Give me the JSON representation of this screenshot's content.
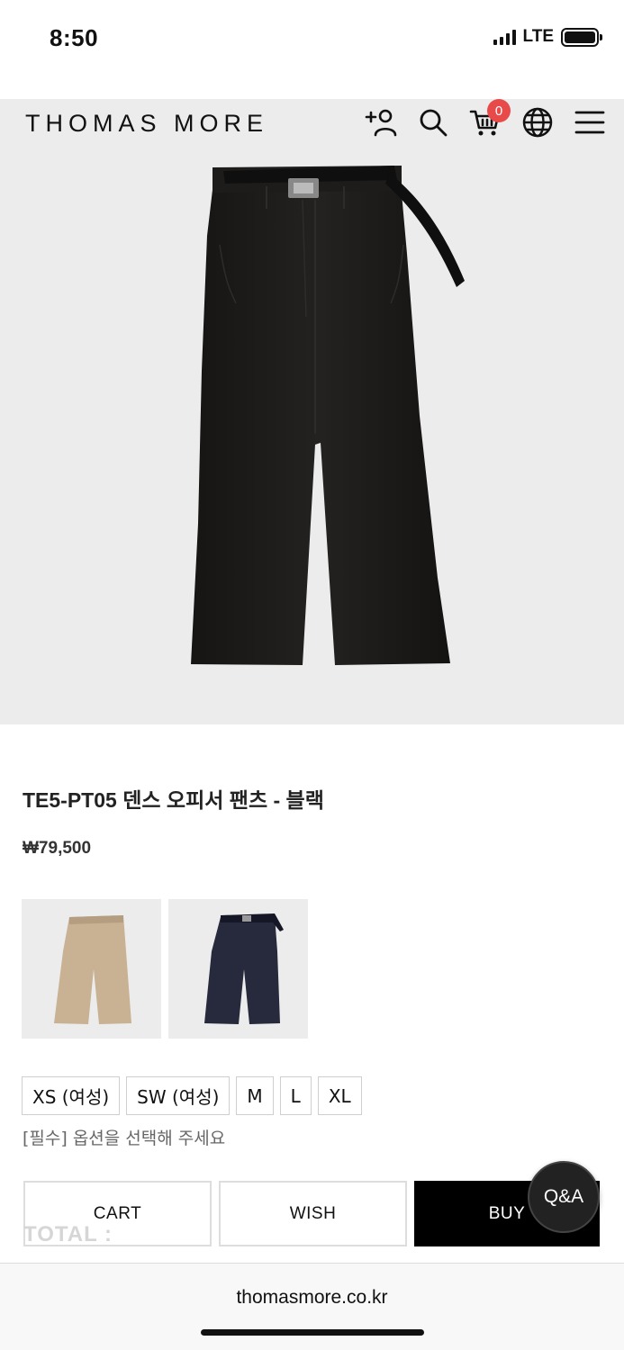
{
  "status": {
    "time": "8:50",
    "network": "LTE"
  },
  "header": {
    "logo": "THOMAS MORE",
    "cart_count": "0"
  },
  "product": {
    "title": "TE5-PT05 덴스 오피서 팬츠 - 블랙",
    "price": "₩79,500",
    "colors": {
      "main": "#1c1b1a",
      "swatch_1": "#c9b193",
      "swatch_2": "#272a3d"
    }
  },
  "sizes": {
    "options": [
      "XS (여성)",
      "SW (여성)",
      "M",
      "L",
      "XL"
    ],
    "required_notice": "[필수] 옵션을 선택해 주세요"
  },
  "actions": {
    "cart": "CART",
    "wish": "WISH",
    "buy": "BUY",
    "total": "TOTAL :",
    "qa": "Q&A"
  },
  "browser": {
    "url": "thomasmore.co.kr"
  }
}
